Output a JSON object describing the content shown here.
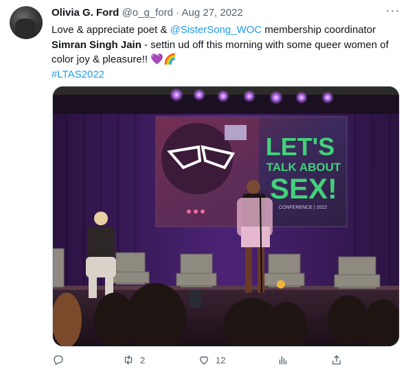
{
  "tweet": {
    "display_name": "Olivia G. Ford",
    "handle": "@o_g_ford",
    "separator": "·",
    "date": "Aug 27, 2022",
    "more_label": "···",
    "text_1": "Love & appreciate poet & ",
    "mention": "@SisterSong_WOC",
    "text_2": " membership coordinator ",
    "bold_name": "Simran Singh Jain",
    "text_3": " - settin ud off this morning with some queer women of color joy & pleasure!! ",
    "emoji_heart": "💜",
    "emoji_rainbow": "🌈",
    "hashtag": "#LTAS2022"
  },
  "media": {
    "screen_line1": "LET'S",
    "screen_line2": "TALK ABOUT",
    "screen_line3": "SEX!",
    "screen_sub": "CONFERENCE | 2022"
  },
  "actions": {
    "reply_count": "",
    "retweet_count": "2",
    "like_count": "12",
    "views_count": ""
  },
  "colors": {
    "link": "#1d9bf0",
    "muted": "#536471",
    "screen_green": "#43d17a",
    "stage_purple": "#5b2a8c"
  }
}
